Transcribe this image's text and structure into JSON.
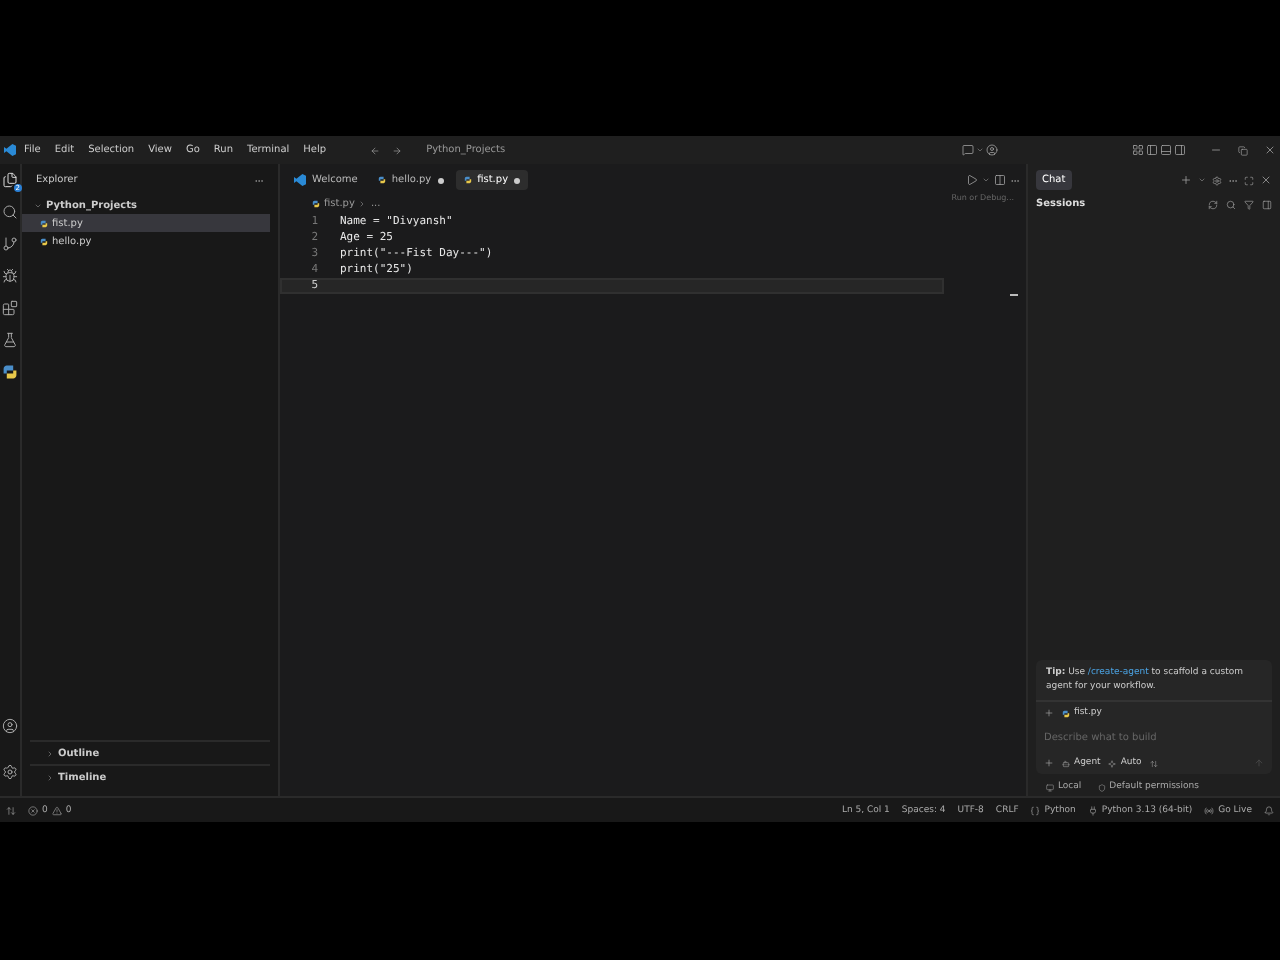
{
  "menu": [
    "File",
    "Edit",
    "Selection",
    "View",
    "Go",
    "Run",
    "Terminal",
    "Help"
  ],
  "command_center": "Python_Projects",
  "activity_badge": "2",
  "explorer": {
    "title": "Explorer",
    "folder": {
      "name": "Python_Projects",
      "expanded": true,
      "children": [
        {
          "name": "fist.py",
          "selected": true
        },
        {
          "name": "hello.py",
          "selected": false
        }
      ]
    },
    "sections": [
      {
        "label": "Outline",
        "expanded": false
      },
      {
        "label": "Timeline",
        "expanded": false
      }
    ]
  },
  "tabs": [
    {
      "label": "Welcome",
      "kind": "welcome",
      "selected": false,
      "modified": false
    },
    {
      "label": "hello.py",
      "kind": "python",
      "selected": false,
      "modified": true
    },
    {
      "label": "fist.py",
      "kind": "python",
      "selected": true,
      "modified": true
    }
  ],
  "breadcrumb": [
    "fist.py",
    "..."
  ],
  "code": [
    {
      "number": "1",
      "text": "Name = \"Divyansh\"",
      "current": false
    },
    {
      "number": "2",
      "text": "Age = 25",
      "current": false
    },
    {
      "number": "3",
      "text": "print(\"---Fist Day---\")",
      "current": false
    },
    {
      "number": "4",
      "text": "print(\"25\")",
      "current": false
    },
    {
      "number": "5",
      "current": true
    }
  ],
  "tooltip": "Run or Debug...",
  "chat": {
    "tab": "Chat",
    "sessions": "Sessions",
    "tip": {
      "lead": "**Tip:** Use",
      "link": "/create-agent",
      "rest": "to scaffold a custom agent for your workflow."
    },
    "context": "fist.py",
    "placeholder": "Describe what to build",
    "mode": "Agent",
    "model": "Auto",
    "footer": [
      "Local",
      "Default permissions"
    ]
  },
  "status": {
    "errors": "0",
    "warnings": "0",
    "right": [
      {
        "text": "Ln 5, Col 1",
        "kind": "plain"
      },
      {
        "text": "Spaces: 4",
        "kind": "plain"
      },
      {
        "text": "UTF-8",
        "kind": "plain"
      },
      {
        "text": "CRLF",
        "kind": "plain"
      },
      {
        "text": "Python",
        "kind": "language"
      },
      {
        "text": "Python 3.13 (64-bit)",
        "kind": "interpreter"
      },
      {
        "text": "Go Live",
        "kind": "live"
      }
    ]
  }
}
